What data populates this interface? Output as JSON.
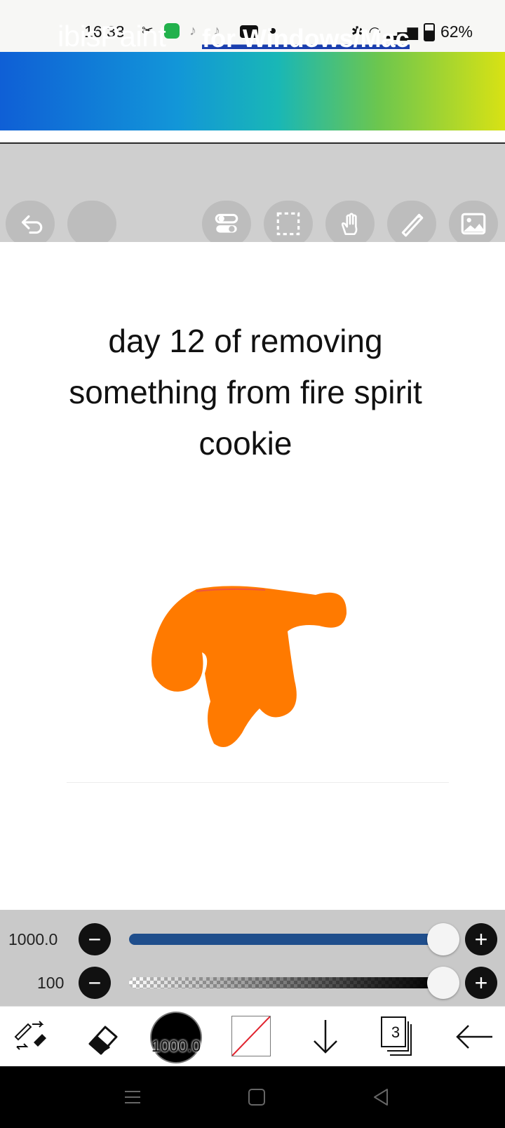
{
  "status_bar": {
    "time": "16:33",
    "left_icons": [
      "capcut-icon",
      "messenger-icon",
      "tiktok-icon",
      "tiktok-icon",
      "youtube-icon",
      "dot-icon"
    ],
    "battery": "62%"
  },
  "ad_banner": {
    "logo": "ibisPaint",
    "tagline": "for Windows/Mac"
  },
  "toolbar": {
    "buttons": [
      "undo-icon",
      "blank",
      "toggle-icon",
      "selection-icon",
      "hand-icon",
      "ruler-icon",
      "image-icon"
    ]
  },
  "canvas": {
    "caption_lines": [
      "day 12 of removing",
      "something from fire spirit",
      "cookie"
    ],
    "drawing_color": "#ff7a00"
  },
  "sliders": {
    "size_value": "1000.0",
    "size_level": 1.0,
    "opacity_value": "100",
    "opacity_level": 1.0
  },
  "bottom_tools": {
    "brush_size_label": "1000.0",
    "layer_count": "3",
    "accent": "#1f4e8c"
  }
}
